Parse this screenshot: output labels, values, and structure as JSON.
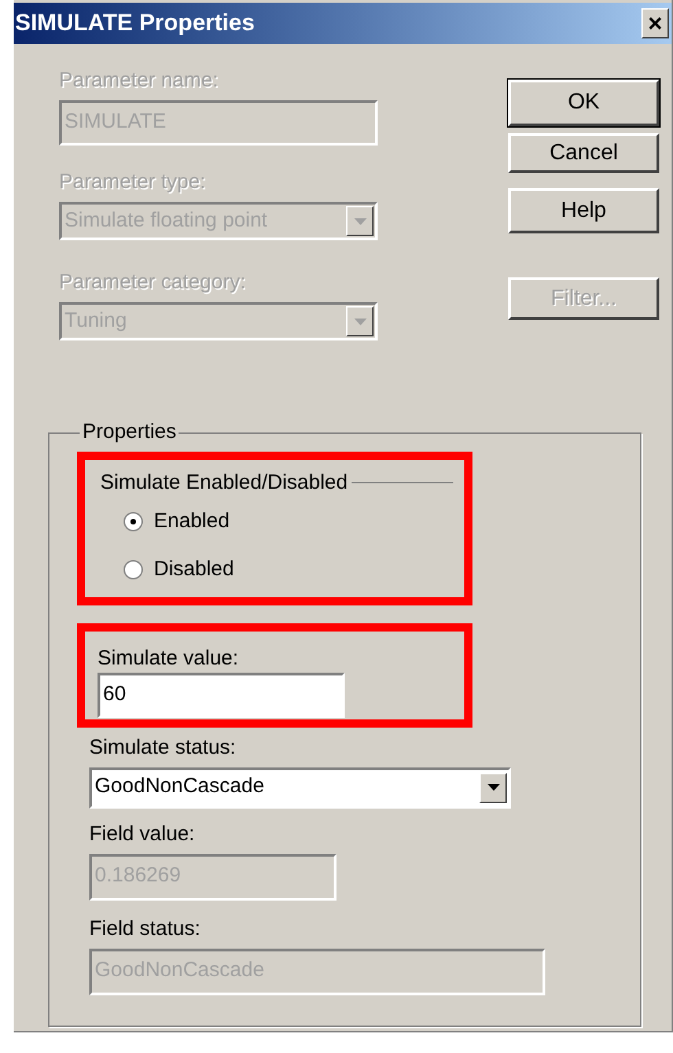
{
  "window": {
    "title": "SIMULATE Properties",
    "close": "×"
  },
  "fields": [
    {
      "label": "Parameter name:",
      "value": "SIMULATE",
      "kind": "text",
      "disabled": true
    },
    {
      "label": "Parameter type:",
      "value": "Simulate floating point",
      "kind": "dropdown",
      "disabled": true
    },
    {
      "label": "Parameter category:",
      "value": "Tuning",
      "kind": "dropdown",
      "disabled": true
    }
  ],
  "buttons": [
    {
      "label": "OK",
      "default": true,
      "disabled": false
    },
    {
      "label": "Cancel",
      "default": false,
      "disabled": false
    },
    {
      "label": "Help",
      "default": false,
      "disabled": false
    },
    {
      "label": "Filter...",
      "default": false,
      "disabled": true
    }
  ],
  "properties": {
    "title": "Properties",
    "enable_group": {
      "title": "Simulate Enabled/Disabled",
      "highlighted": true,
      "options": [
        {
          "label": "Enabled",
          "selected": true
        },
        {
          "label": "Disabled",
          "selected": false
        }
      ]
    },
    "simulate_value": {
      "label": "Simulate value:",
      "value": "60",
      "highlighted": true
    },
    "fields": [
      {
        "label": "Simulate status:",
        "value": "GoodNonCascade",
        "kind": "dropdown",
        "disabled": false
      },
      {
        "label": "Field value:",
        "value": "0.186269",
        "kind": "text",
        "disabled": true
      },
      {
        "label": "Field status:",
        "value": "GoodNonCascade",
        "kind": "text",
        "disabled": true
      }
    ]
  }
}
